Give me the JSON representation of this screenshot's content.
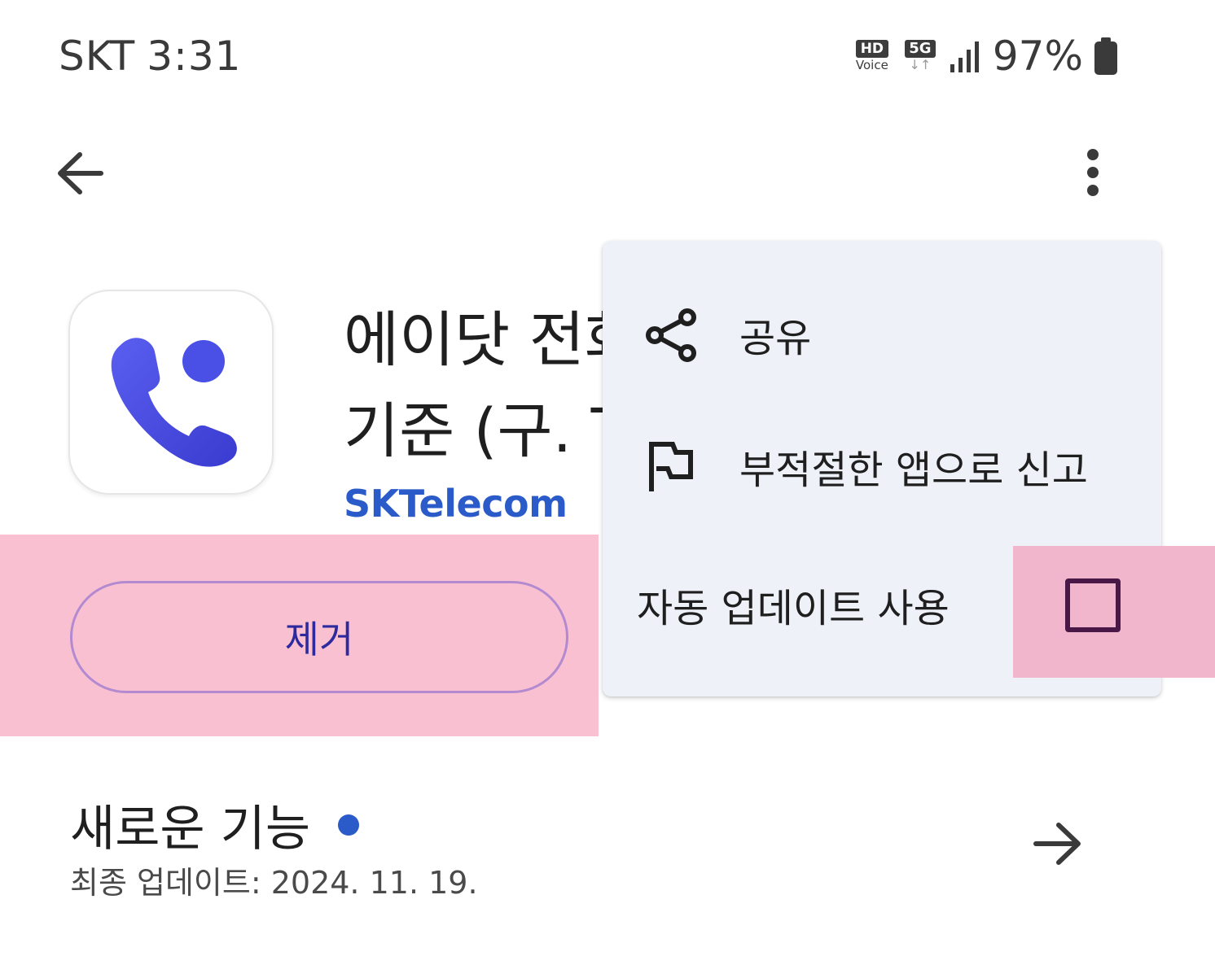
{
  "status_bar": {
    "carrier": "SKT",
    "time": "3:31",
    "hd_label": "HD",
    "voice_label": "Voice",
    "network": "5G",
    "battery": "97%"
  },
  "app_bar": {
    "back_icon": "arrow-back-icon",
    "more_icon": "more-vert-icon"
  },
  "app": {
    "title_line1": "에이닷 전화",
    "title_line2": "기준 (구. T",
    "developer": "SKTelecom",
    "icon": "phone-app-icon"
  },
  "actions": {
    "remove_label": "제거"
  },
  "whats_new": {
    "title": "새로운 기능",
    "last_updated": "최종 업데이트: 2024. 11. 19.",
    "forward_icon": "arrow-forward-icon"
  },
  "menu": {
    "items": [
      {
        "label": "공유",
        "icon": "share-icon"
      },
      {
        "label": "부적절한 앱으로 신고",
        "icon": "flag-icon"
      },
      {
        "label": "자동 업데이트 사용",
        "checked": false
      }
    ]
  },
  "colors": {
    "developer": "#2b5bc8",
    "highlight": "#f9c0d2",
    "menu_bg": "#eef2f8",
    "button_outline": "#b38ad0",
    "button_text": "#2c2a9e",
    "checkbox": "#4a1846"
  }
}
